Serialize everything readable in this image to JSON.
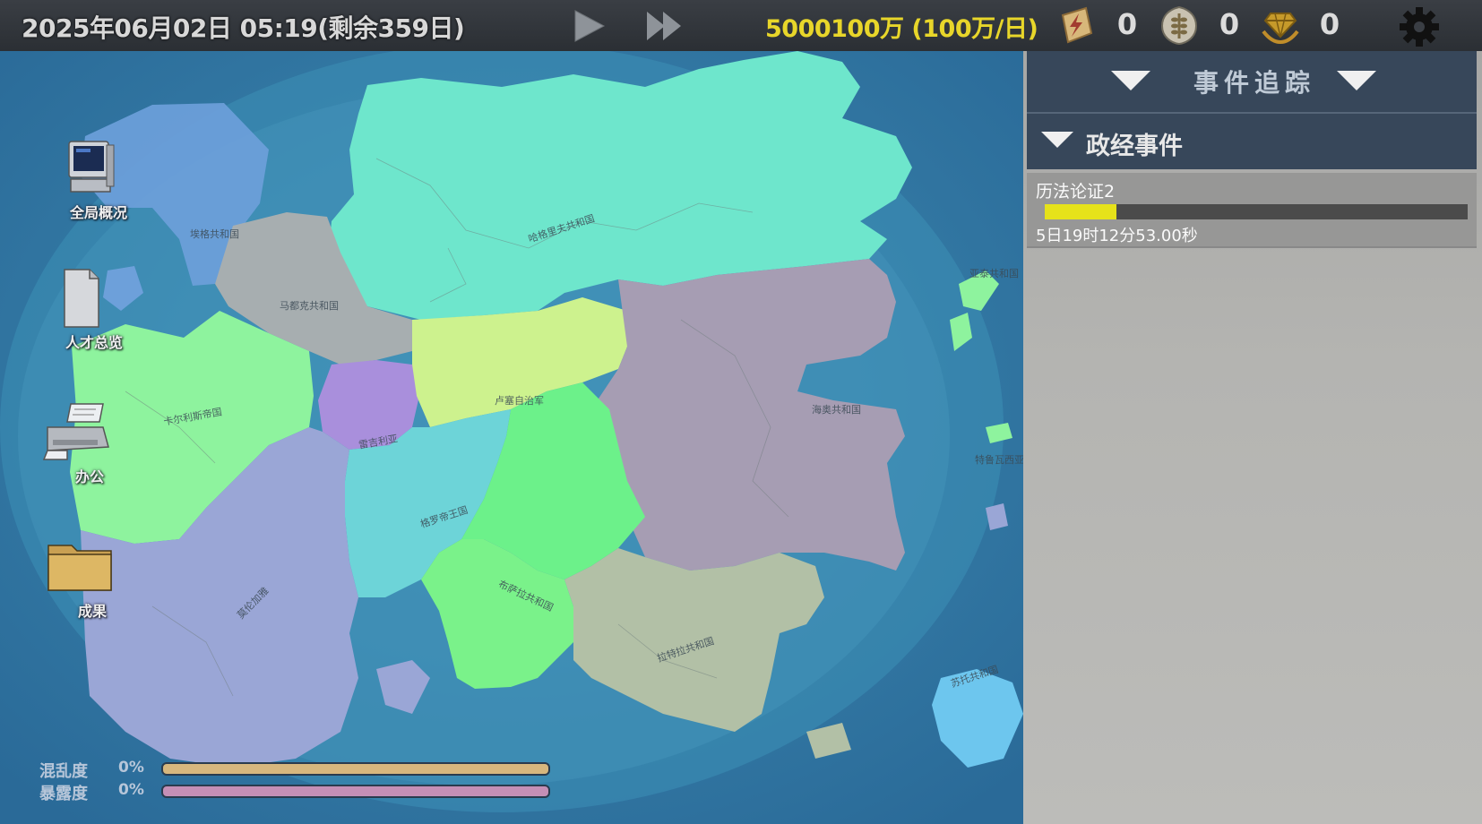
{
  "topbar": {
    "date": "2025年06月02日 05:19(剩余359日)",
    "money": "5000100万 (100万/日)",
    "resources": [
      {
        "icon": "lightning-scroll-icon",
        "value": "0"
      },
      {
        "icon": "wheat-badge-icon",
        "value": "0"
      },
      {
        "icon": "diamond-hands-icon",
        "value": "0"
      }
    ],
    "colors": {
      "money": "#e8d62a"
    }
  },
  "desktop": {
    "items": [
      {
        "label": "全局概况",
        "icon": "computer-icon"
      },
      {
        "label": "人才总览",
        "icon": "document-icon"
      },
      {
        "label": "办公",
        "icon": "printer-icon"
      },
      {
        "label": "成果",
        "icon": "folder-icon"
      }
    ]
  },
  "meters": [
    {
      "label": "混乱度",
      "value": "0%",
      "fraction": 0,
      "color": "#d7b77e"
    },
    {
      "label": "暴露度",
      "value": "0%",
      "fraction": 0,
      "color": "#c58fb6"
    }
  ],
  "map": {
    "regions": [
      "埃格共和国",
      "马都克共和国",
      "哈格里夫共和国",
      "卡尔利斯帝国",
      "雷吉利亚",
      "卢塞自治军",
      "海奥共和国",
      "格罗帝王国",
      "莫伦加雅",
      "布萨拉共和国",
      "拉特拉共和国",
      "亚泰共和国",
      "特鲁瓦西亚",
      "苏托共和国"
    ]
  },
  "panel": {
    "title": "事件追踪",
    "category": "政经事件",
    "events": [
      {
        "name": "历法论证2",
        "progress": 0.17,
        "time": "5日19时12分53.00秒"
      }
    ]
  }
}
